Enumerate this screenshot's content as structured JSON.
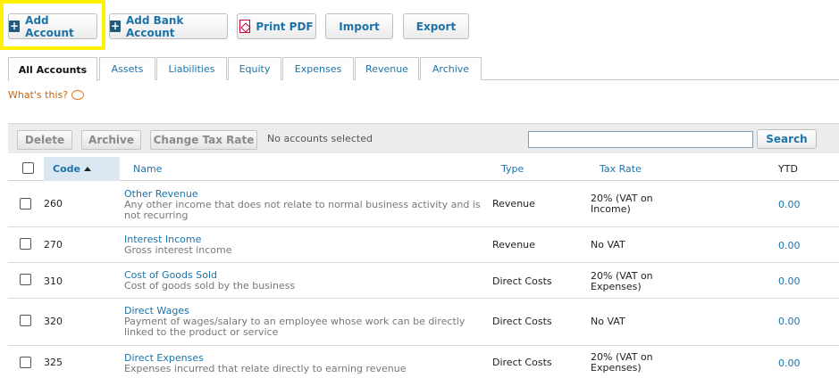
{
  "toolbar": {
    "add_account": "Add Account",
    "add_bank_account": "Add Bank Account",
    "print_pdf": "Print PDF",
    "import": "Import",
    "export": "Export"
  },
  "tabs": [
    "All Accounts",
    "Assets",
    "Liabilities",
    "Equity",
    "Expenses",
    "Revenue",
    "Archive"
  ],
  "whats_this": "What's this?",
  "grid_toolbar": {
    "delete": "Delete",
    "archive": "Archive",
    "change_tax_rate": "Change Tax Rate",
    "status": "No accounts selected",
    "search_value": "",
    "search": "Search"
  },
  "columns": {
    "code": "Code",
    "name": "Name",
    "type": "Type",
    "tax_rate": "Tax Rate",
    "ytd": "YTD"
  },
  "rows": [
    {
      "code": "260",
      "name": "Other Revenue",
      "desc": "Any other income that does not relate to normal business activity and is not recurring",
      "type": "Revenue",
      "tax": "20% (VAT on Income)",
      "ytd": "0.00"
    },
    {
      "code": "270",
      "name": "Interest Income",
      "desc": "Gross interest income",
      "type": "Revenue",
      "tax": "No VAT",
      "ytd": "0.00"
    },
    {
      "code": "310",
      "name": "Cost of Goods Sold",
      "desc": "Cost of goods sold by the business",
      "type": "Direct Costs",
      "tax": "20% (VAT on Expenses)",
      "ytd": "0.00"
    },
    {
      "code": "320",
      "name": "Direct Wages",
      "desc": "Payment of wages/salary to an employee whose work can be directly linked to the product or service",
      "type": "Direct Costs",
      "tax": "No VAT",
      "ytd": "0.00"
    },
    {
      "code": "325",
      "name": "Direct Expenses",
      "desc": "Expenses incurred that relate directly to earning revenue",
      "type": "Direct Costs",
      "tax": "20% (VAT on Expenses)",
      "ytd": "0.00"
    }
  ]
}
